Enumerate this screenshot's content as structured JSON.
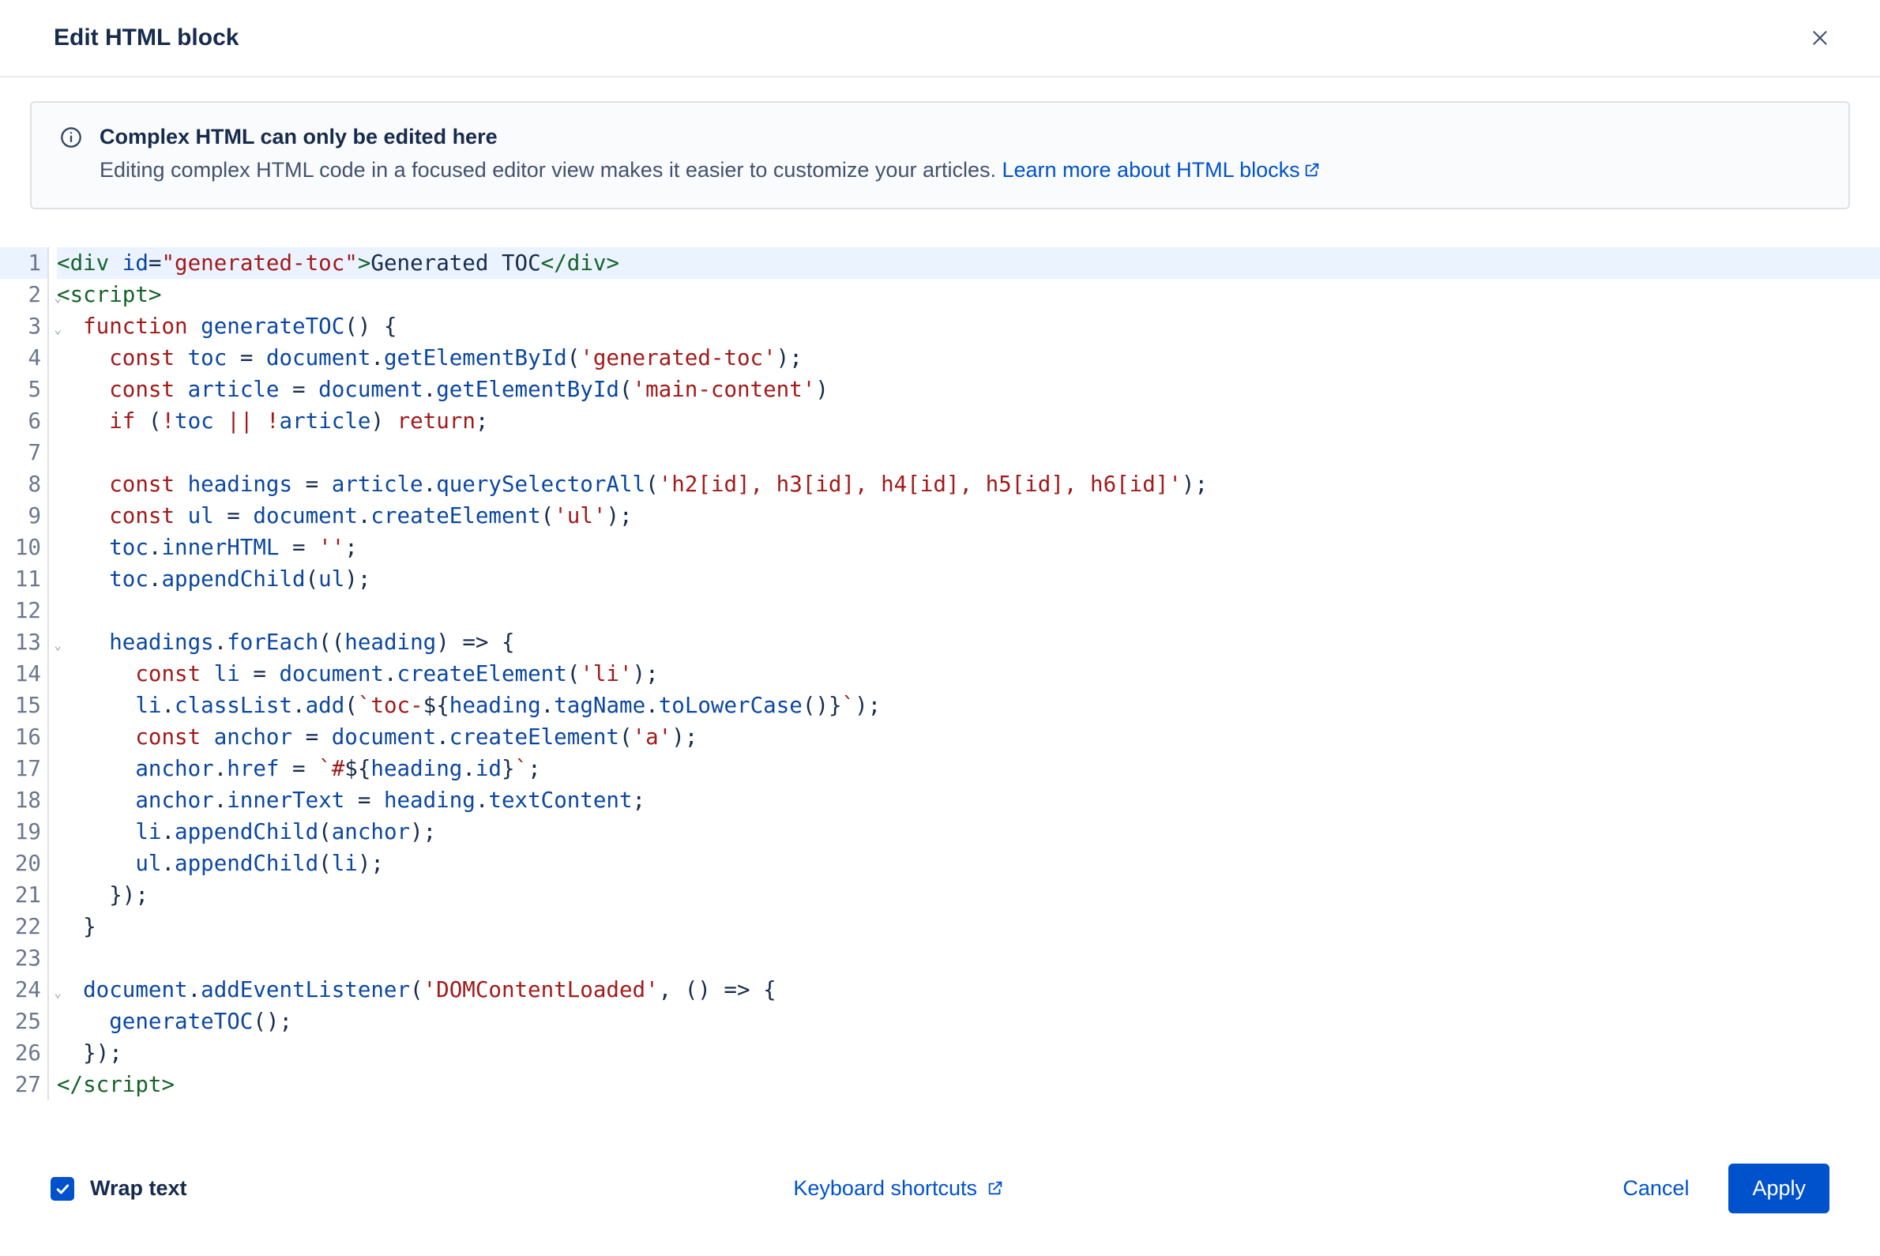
{
  "header": {
    "title": "Edit HTML block"
  },
  "banner": {
    "title": "Complex HTML can only be edited here",
    "text": "Editing complex HTML code in a focused editor view makes it easier to customize your articles. ",
    "link_label": "Learn more about HTML blocks"
  },
  "editor": {
    "highlighted_line": 1,
    "fold_lines": [
      2,
      3,
      13,
      24
    ],
    "lines": [
      [
        {
          "t": "<",
          "c": "tok-tag"
        },
        {
          "t": "div",
          "c": "tok-tag"
        },
        {
          "t": " ",
          "c": "tok-plain"
        },
        {
          "t": "id",
          "c": "tok-attr"
        },
        {
          "t": "=",
          "c": "tok-punc"
        },
        {
          "t": "\"generated-toc\"",
          "c": "tok-str"
        },
        {
          "t": ">",
          "c": "tok-tag"
        },
        {
          "t": "Generated TOC",
          "c": "tok-plain"
        },
        {
          "t": "</",
          "c": "tok-tag"
        },
        {
          "t": "div",
          "c": "tok-tag"
        },
        {
          "t": ">",
          "c": "tok-tag"
        }
      ],
      [
        {
          "t": "<",
          "c": "tok-tag"
        },
        {
          "t": "script",
          "c": "tok-tag"
        },
        {
          "t": ">",
          "c": "tok-tag"
        }
      ],
      [
        {
          "t": "  ",
          "c": "tok-plain"
        },
        {
          "t": "function",
          "c": "tok-kw"
        },
        {
          "t": " ",
          "c": "tok-plain"
        },
        {
          "t": "generateTOC",
          "c": "tok-fn"
        },
        {
          "t": "() {",
          "c": "tok-punc"
        }
      ],
      [
        {
          "t": "    ",
          "c": "tok-plain"
        },
        {
          "t": "const",
          "c": "tok-kw"
        },
        {
          "t": " ",
          "c": "tok-plain"
        },
        {
          "t": "toc",
          "c": "tok-prop"
        },
        {
          "t": " = ",
          "c": "tok-punc"
        },
        {
          "t": "document",
          "c": "tok-prop"
        },
        {
          "t": ".",
          "c": "tok-punc"
        },
        {
          "t": "getElementById",
          "c": "tok-fn"
        },
        {
          "t": "(",
          "c": "tok-punc"
        },
        {
          "t": "'generated-toc'",
          "c": "tok-str"
        },
        {
          "t": ");",
          "c": "tok-punc"
        }
      ],
      [
        {
          "t": "    ",
          "c": "tok-plain"
        },
        {
          "t": "const",
          "c": "tok-kw"
        },
        {
          "t": " ",
          "c": "tok-plain"
        },
        {
          "t": "article",
          "c": "tok-prop"
        },
        {
          "t": " = ",
          "c": "tok-punc"
        },
        {
          "t": "document",
          "c": "tok-prop"
        },
        {
          "t": ".",
          "c": "tok-punc"
        },
        {
          "t": "getElementById",
          "c": "tok-fn"
        },
        {
          "t": "(",
          "c": "tok-punc"
        },
        {
          "t": "'main-content'",
          "c": "tok-str"
        },
        {
          "t": ")",
          "c": "tok-punc"
        }
      ],
      [
        {
          "t": "    ",
          "c": "tok-plain"
        },
        {
          "t": "if",
          "c": "tok-kw"
        },
        {
          "t": " (",
          "c": "tok-punc"
        },
        {
          "t": "!",
          "c": "tok-op"
        },
        {
          "t": "toc",
          "c": "tok-prop"
        },
        {
          "t": " ",
          "c": "tok-plain"
        },
        {
          "t": "||",
          "c": "tok-op"
        },
        {
          "t": " ",
          "c": "tok-plain"
        },
        {
          "t": "!",
          "c": "tok-op"
        },
        {
          "t": "article",
          "c": "tok-prop"
        },
        {
          "t": ") ",
          "c": "tok-punc"
        },
        {
          "t": "return",
          "c": "tok-kw"
        },
        {
          "t": ";",
          "c": "tok-punc"
        }
      ],
      [
        {
          "t": " ",
          "c": "tok-plain"
        }
      ],
      [
        {
          "t": "    ",
          "c": "tok-plain"
        },
        {
          "t": "const",
          "c": "tok-kw"
        },
        {
          "t": " ",
          "c": "tok-plain"
        },
        {
          "t": "headings",
          "c": "tok-prop"
        },
        {
          "t": " = ",
          "c": "tok-punc"
        },
        {
          "t": "article",
          "c": "tok-prop"
        },
        {
          "t": ".",
          "c": "tok-punc"
        },
        {
          "t": "querySelectorAll",
          "c": "tok-fn"
        },
        {
          "t": "(",
          "c": "tok-punc"
        },
        {
          "t": "'h2[id], h3[id], h4[id], h5[id], h6[id]'",
          "c": "tok-str"
        },
        {
          "t": ");",
          "c": "tok-punc"
        }
      ],
      [
        {
          "t": "    ",
          "c": "tok-plain"
        },
        {
          "t": "const",
          "c": "tok-kw"
        },
        {
          "t": " ",
          "c": "tok-plain"
        },
        {
          "t": "ul",
          "c": "tok-prop"
        },
        {
          "t": " = ",
          "c": "tok-punc"
        },
        {
          "t": "document",
          "c": "tok-prop"
        },
        {
          "t": ".",
          "c": "tok-punc"
        },
        {
          "t": "createElement",
          "c": "tok-fn"
        },
        {
          "t": "(",
          "c": "tok-punc"
        },
        {
          "t": "'ul'",
          "c": "tok-str"
        },
        {
          "t": ");",
          "c": "tok-punc"
        }
      ],
      [
        {
          "t": "    ",
          "c": "tok-plain"
        },
        {
          "t": "toc",
          "c": "tok-prop"
        },
        {
          "t": ".",
          "c": "tok-punc"
        },
        {
          "t": "innerHTML",
          "c": "tok-prop"
        },
        {
          "t": " = ",
          "c": "tok-punc"
        },
        {
          "t": "''",
          "c": "tok-str"
        },
        {
          "t": ";",
          "c": "tok-punc"
        }
      ],
      [
        {
          "t": "    ",
          "c": "tok-plain"
        },
        {
          "t": "toc",
          "c": "tok-prop"
        },
        {
          "t": ".",
          "c": "tok-punc"
        },
        {
          "t": "appendChild",
          "c": "tok-fn"
        },
        {
          "t": "(",
          "c": "tok-punc"
        },
        {
          "t": "ul",
          "c": "tok-prop"
        },
        {
          "t": ");",
          "c": "tok-punc"
        }
      ],
      [
        {
          "t": " ",
          "c": "tok-plain"
        }
      ],
      [
        {
          "t": "    ",
          "c": "tok-plain"
        },
        {
          "t": "headings",
          "c": "tok-prop"
        },
        {
          "t": ".",
          "c": "tok-punc"
        },
        {
          "t": "forEach",
          "c": "tok-fn"
        },
        {
          "t": "((",
          "c": "tok-punc"
        },
        {
          "t": "heading",
          "c": "tok-prop"
        },
        {
          "t": ") ",
          "c": "tok-punc"
        },
        {
          "t": "=>",
          "c": "tok-punc"
        },
        {
          "t": " {",
          "c": "tok-punc"
        }
      ],
      [
        {
          "t": "      ",
          "c": "tok-plain"
        },
        {
          "t": "const",
          "c": "tok-kw"
        },
        {
          "t": " ",
          "c": "tok-plain"
        },
        {
          "t": "li",
          "c": "tok-prop"
        },
        {
          "t": " = ",
          "c": "tok-punc"
        },
        {
          "t": "document",
          "c": "tok-prop"
        },
        {
          "t": ".",
          "c": "tok-punc"
        },
        {
          "t": "createElement",
          "c": "tok-fn"
        },
        {
          "t": "(",
          "c": "tok-punc"
        },
        {
          "t": "'li'",
          "c": "tok-str"
        },
        {
          "t": ");",
          "c": "tok-punc"
        }
      ],
      [
        {
          "t": "      ",
          "c": "tok-plain"
        },
        {
          "t": "li",
          "c": "tok-prop"
        },
        {
          "t": ".",
          "c": "tok-punc"
        },
        {
          "t": "classList",
          "c": "tok-prop"
        },
        {
          "t": ".",
          "c": "tok-punc"
        },
        {
          "t": "add",
          "c": "tok-fn"
        },
        {
          "t": "(",
          "c": "tok-punc"
        },
        {
          "t": "`toc-",
          "c": "tok-str"
        },
        {
          "t": "${",
          "c": "tok-punc"
        },
        {
          "t": "heading",
          "c": "tok-prop"
        },
        {
          "t": ".",
          "c": "tok-punc"
        },
        {
          "t": "tagName",
          "c": "tok-prop"
        },
        {
          "t": ".",
          "c": "tok-punc"
        },
        {
          "t": "toLowerCase",
          "c": "tok-fn"
        },
        {
          "t": "()",
          "c": "tok-punc"
        },
        {
          "t": "}",
          "c": "tok-punc"
        },
        {
          "t": "`",
          "c": "tok-str"
        },
        {
          "t": ");",
          "c": "tok-punc"
        }
      ],
      [
        {
          "t": "      ",
          "c": "tok-plain"
        },
        {
          "t": "const",
          "c": "tok-kw"
        },
        {
          "t": " ",
          "c": "tok-plain"
        },
        {
          "t": "anchor",
          "c": "tok-prop"
        },
        {
          "t": " = ",
          "c": "tok-punc"
        },
        {
          "t": "document",
          "c": "tok-prop"
        },
        {
          "t": ".",
          "c": "tok-punc"
        },
        {
          "t": "createElement",
          "c": "tok-fn"
        },
        {
          "t": "(",
          "c": "tok-punc"
        },
        {
          "t": "'a'",
          "c": "tok-str"
        },
        {
          "t": ");",
          "c": "tok-punc"
        }
      ],
      [
        {
          "t": "      ",
          "c": "tok-plain"
        },
        {
          "t": "anchor",
          "c": "tok-prop"
        },
        {
          "t": ".",
          "c": "tok-punc"
        },
        {
          "t": "href",
          "c": "tok-prop"
        },
        {
          "t": " = ",
          "c": "tok-punc"
        },
        {
          "t": "`#",
          "c": "tok-str"
        },
        {
          "t": "${",
          "c": "tok-punc"
        },
        {
          "t": "heading",
          "c": "tok-prop"
        },
        {
          "t": ".",
          "c": "tok-punc"
        },
        {
          "t": "id",
          "c": "tok-prop"
        },
        {
          "t": "}",
          "c": "tok-punc"
        },
        {
          "t": "`",
          "c": "tok-str"
        },
        {
          "t": ";",
          "c": "tok-punc"
        }
      ],
      [
        {
          "t": "      ",
          "c": "tok-plain"
        },
        {
          "t": "anchor",
          "c": "tok-prop"
        },
        {
          "t": ".",
          "c": "tok-punc"
        },
        {
          "t": "innerText",
          "c": "tok-prop"
        },
        {
          "t": " = ",
          "c": "tok-punc"
        },
        {
          "t": "heading",
          "c": "tok-prop"
        },
        {
          "t": ".",
          "c": "tok-punc"
        },
        {
          "t": "textContent",
          "c": "tok-prop"
        },
        {
          "t": ";",
          "c": "tok-punc"
        }
      ],
      [
        {
          "t": "      ",
          "c": "tok-plain"
        },
        {
          "t": "li",
          "c": "tok-prop"
        },
        {
          "t": ".",
          "c": "tok-punc"
        },
        {
          "t": "appendChild",
          "c": "tok-fn"
        },
        {
          "t": "(",
          "c": "tok-punc"
        },
        {
          "t": "anchor",
          "c": "tok-prop"
        },
        {
          "t": ");",
          "c": "tok-punc"
        }
      ],
      [
        {
          "t": "      ",
          "c": "tok-plain"
        },
        {
          "t": "ul",
          "c": "tok-prop"
        },
        {
          "t": ".",
          "c": "tok-punc"
        },
        {
          "t": "appendChild",
          "c": "tok-fn"
        },
        {
          "t": "(",
          "c": "tok-punc"
        },
        {
          "t": "li",
          "c": "tok-prop"
        },
        {
          "t": ");",
          "c": "tok-punc"
        }
      ],
      [
        {
          "t": "    });",
          "c": "tok-punc"
        }
      ],
      [
        {
          "t": "  }",
          "c": "tok-punc"
        }
      ],
      [
        {
          "t": " ",
          "c": "tok-plain"
        }
      ],
      [
        {
          "t": "  ",
          "c": "tok-plain"
        },
        {
          "t": "document",
          "c": "tok-prop"
        },
        {
          "t": ".",
          "c": "tok-punc"
        },
        {
          "t": "addEventListener",
          "c": "tok-fn"
        },
        {
          "t": "(",
          "c": "tok-punc"
        },
        {
          "t": "'DOMContentLoaded'",
          "c": "tok-str"
        },
        {
          "t": ", () ",
          "c": "tok-punc"
        },
        {
          "t": "=>",
          "c": "tok-punc"
        },
        {
          "t": " {",
          "c": "tok-punc"
        }
      ],
      [
        {
          "t": "    ",
          "c": "tok-plain"
        },
        {
          "t": "generateTOC",
          "c": "tok-fn"
        },
        {
          "t": "();",
          "c": "tok-punc"
        }
      ],
      [
        {
          "t": "  });",
          "c": "tok-punc"
        }
      ],
      [
        {
          "t": "</",
          "c": "tok-tag"
        },
        {
          "t": "script",
          "c": "tok-tag"
        },
        {
          "t": ">",
          "c": "tok-tag"
        }
      ]
    ]
  },
  "footer": {
    "wrap_label": "Wrap text",
    "wrap_checked": true,
    "shortcuts_label": "Keyboard shortcuts",
    "cancel_label": "Cancel",
    "apply_label": "Apply"
  }
}
